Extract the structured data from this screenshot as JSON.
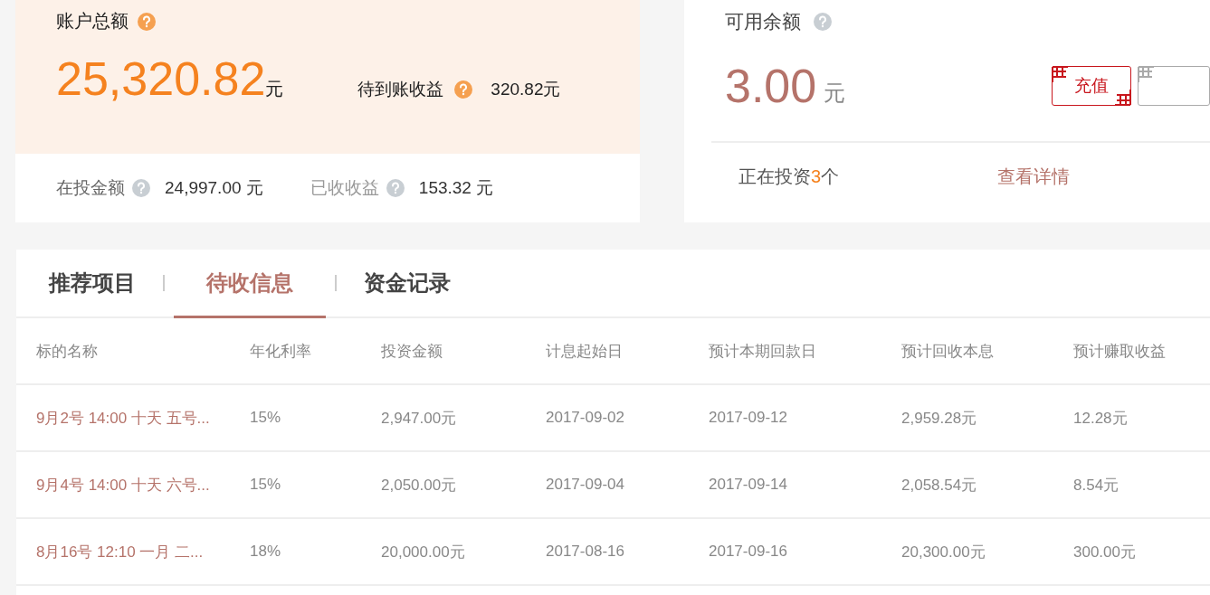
{
  "account": {
    "title": "账户总额",
    "total": "25,320.82",
    "total_unit": "元",
    "pending_label": "待到账收益",
    "pending_value": "320.82元",
    "stats": [
      {
        "label": "在投金额",
        "value": "24,997.00 元"
      },
      {
        "label": "已收收益",
        "value": "153.32 元"
      }
    ]
  },
  "balance": {
    "title": "可用余额",
    "amount": "3.00",
    "unit": "元",
    "button": "充值",
    "investing_prefix": "正在投资",
    "investing_count": "3",
    "investing_suffix": "个",
    "details_link": "查看详情"
  },
  "tabs": [
    {
      "label": "推荐项目",
      "selected": false
    },
    {
      "label": "待收信息",
      "selected": true
    },
    {
      "label": "资金记录",
      "selected": false
    }
  ],
  "table": {
    "columns": [
      "标的名称",
      "年化利率",
      "投资金额",
      "计息起始日",
      "预计本期回款日",
      "预计回收本息",
      "预计赚取收益"
    ],
    "rows": [
      [
        "9月2号 14:00 十天 五号...",
        "15%",
        "2,947.00元",
        "2017-09-02",
        "2017-09-12",
        "2,959.28元",
        "12.28元"
      ],
      [
        "9月4号 14:00 十天 六号...",
        "15%",
        "2,050.00元",
        "2017-09-04",
        "2017-09-14",
        "2,058.54元",
        "8.54元"
      ],
      [
        "8月16号 12:10 一月 二...",
        "18%",
        "20,000.00元",
        "2017-08-16",
        "2017-09-16",
        "20,300.00元",
        "300.00元"
      ]
    ]
  }
}
